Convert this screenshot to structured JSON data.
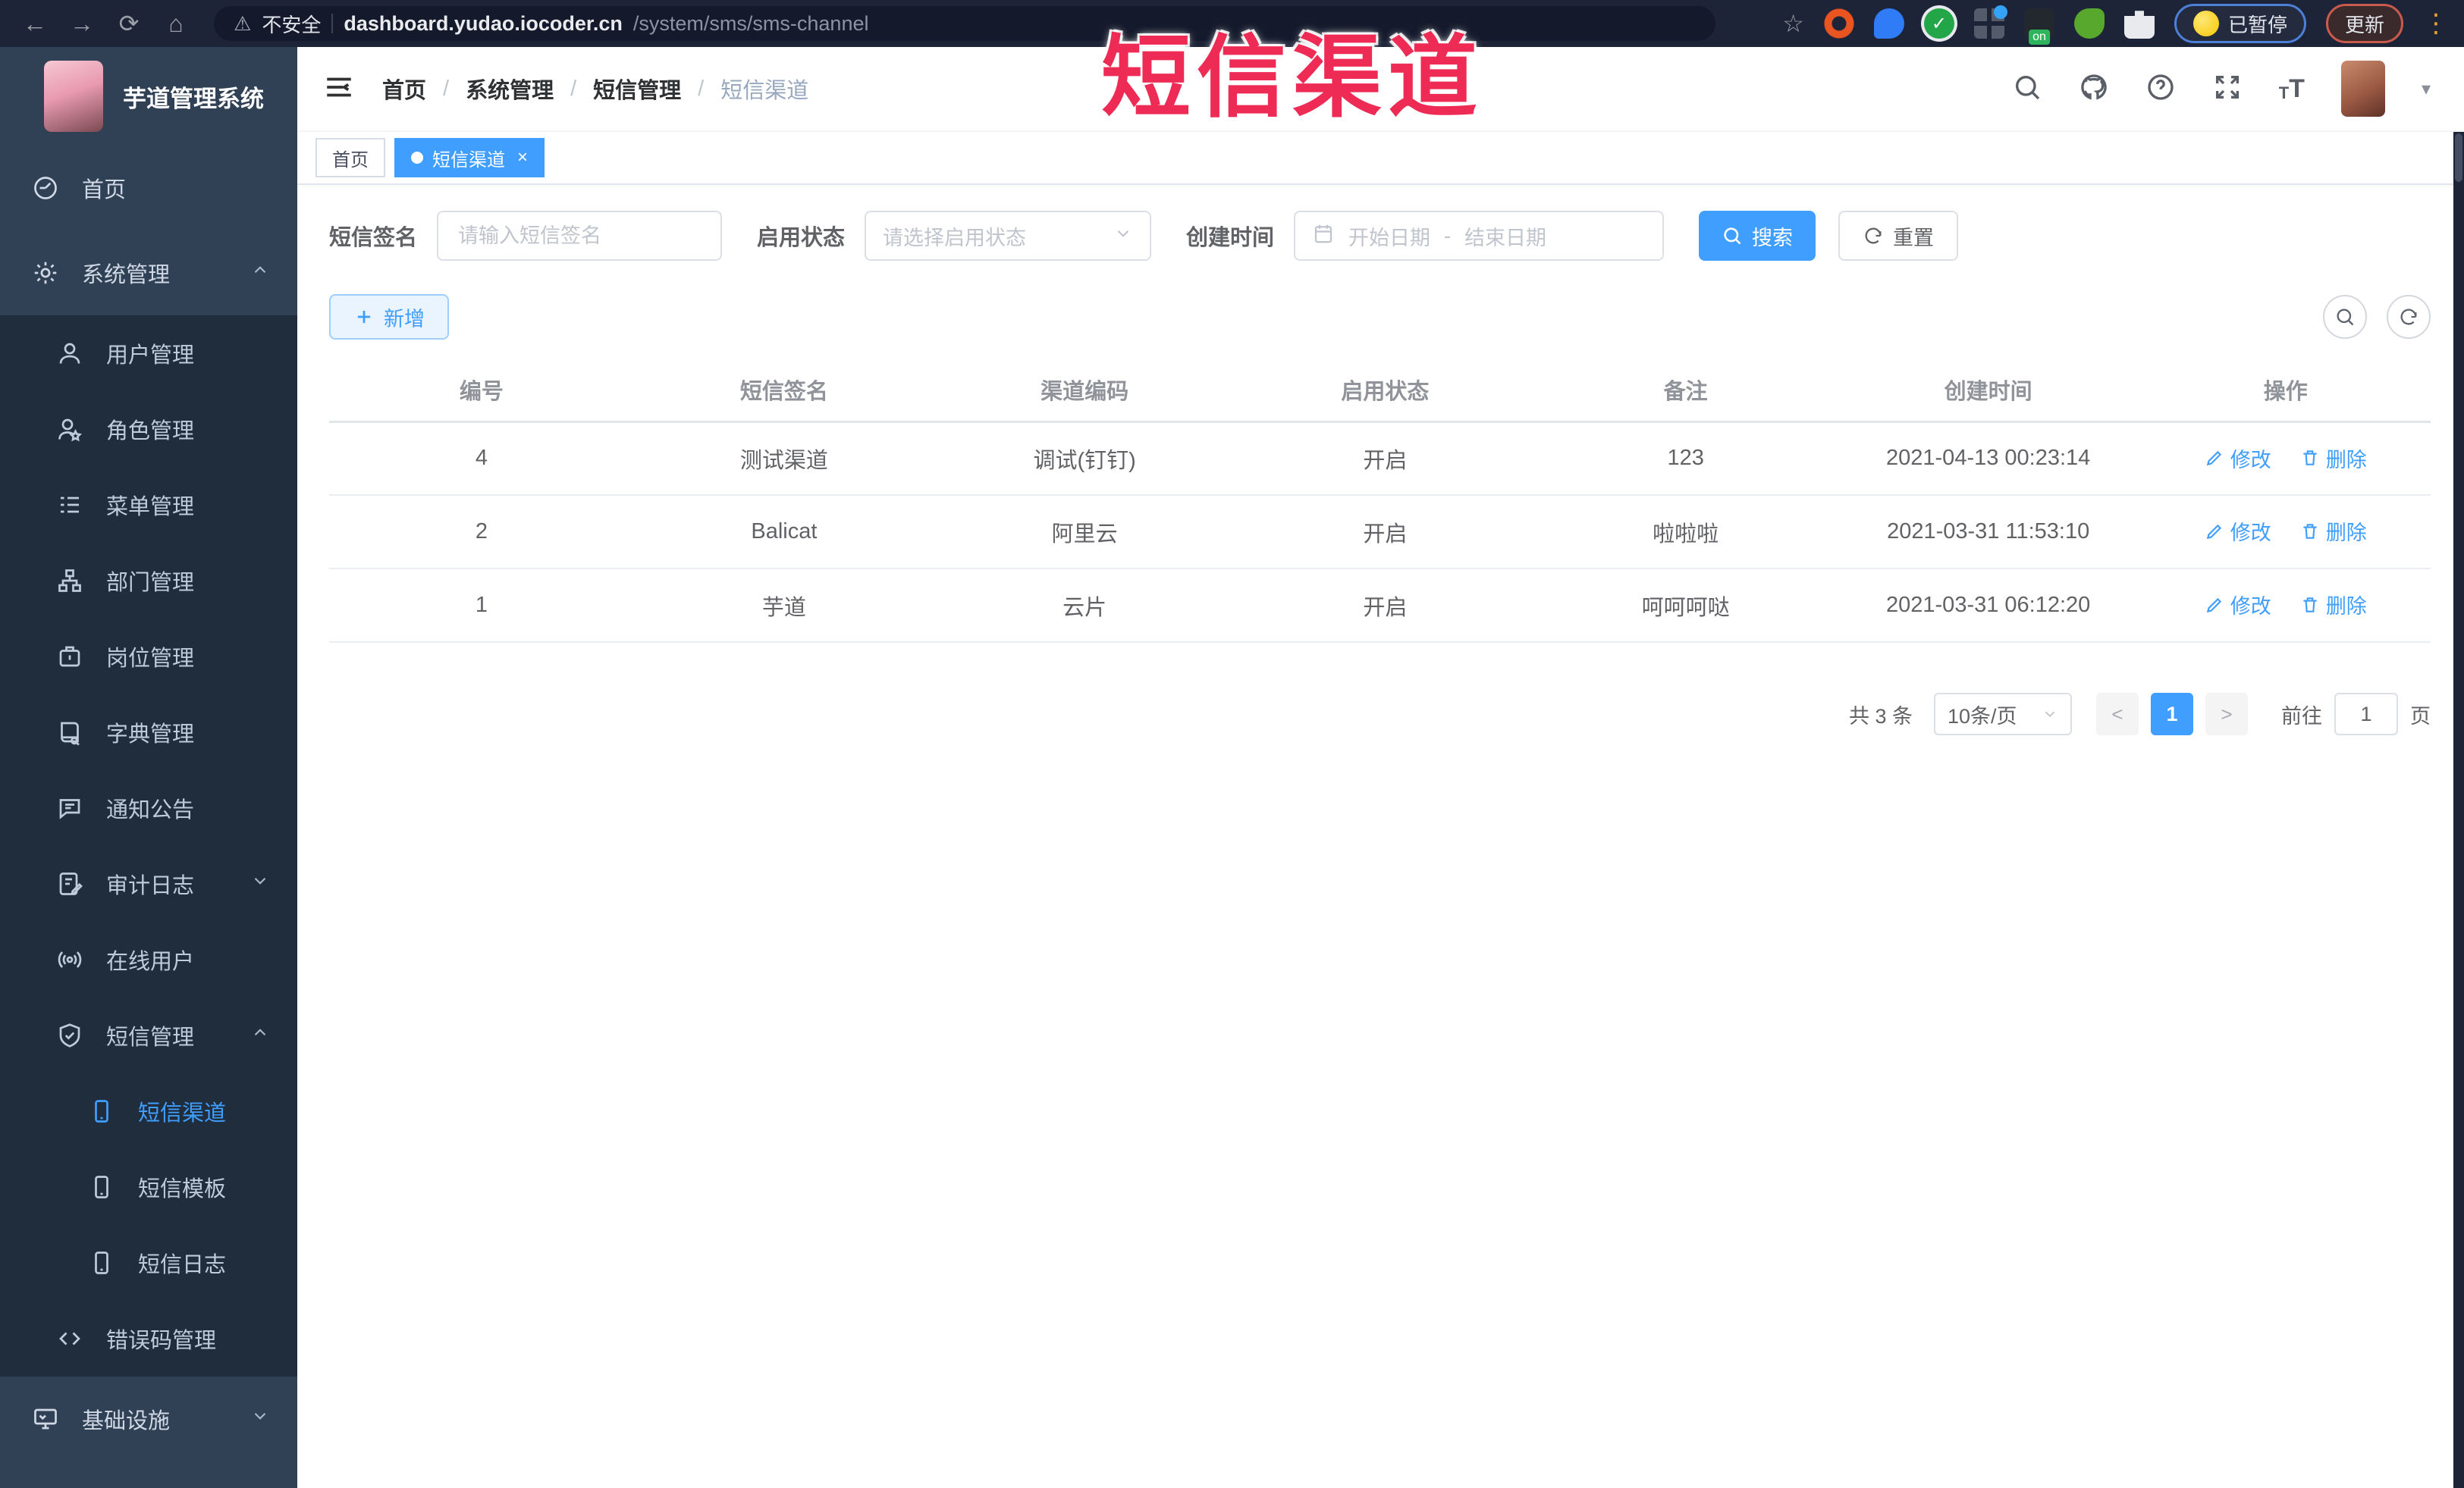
{
  "browser": {
    "security_label": "不安全",
    "url_host": "dashboard.yudao.iocoder.cn",
    "url_path": "/system/sms/sms-channel",
    "paused_label": "已暂停",
    "update_label": "更新"
  },
  "overlay": {
    "title": "短信渠道",
    "color": "#ee2b54"
  },
  "sidebar": {
    "app_title": "芋道管理系统",
    "items": [
      {
        "label": "首页",
        "icon": "dashboard-icon",
        "level": 1
      },
      {
        "label": "系统管理",
        "icon": "gear-icon",
        "level": 1,
        "state": "expanded"
      },
      {
        "label": "用户管理",
        "icon": "user-icon",
        "level": 2
      },
      {
        "label": "角色管理",
        "icon": "role-icon",
        "level": 2
      },
      {
        "label": "菜单管理",
        "icon": "menu-list-icon",
        "level": 2
      },
      {
        "label": "部门管理",
        "icon": "org-tree-icon",
        "level": 2
      },
      {
        "label": "岗位管理",
        "icon": "post-icon",
        "level": 2
      },
      {
        "label": "字典管理",
        "icon": "dict-icon",
        "level": 2
      },
      {
        "label": "通知公告",
        "icon": "notice-icon",
        "level": 2
      },
      {
        "label": "审计日志",
        "icon": "audit-log-icon",
        "level": 2,
        "state": "collapsed"
      },
      {
        "label": "在线用户",
        "icon": "online-user-icon",
        "level": 2
      },
      {
        "label": "短信管理",
        "icon": "sms-shield-icon",
        "level": 2,
        "state": "expanded"
      },
      {
        "label": "短信渠道",
        "icon": "phone-icon",
        "level": 3,
        "active": true
      },
      {
        "label": "短信模板",
        "icon": "phone-icon",
        "level": 3
      },
      {
        "label": "短信日志",
        "icon": "phone-icon",
        "level": 3
      },
      {
        "label": "错误码管理",
        "icon": "code-icon",
        "level": 2
      },
      {
        "label": "基础设施",
        "icon": "infra-icon",
        "level": 1,
        "state": "collapsed"
      }
    ]
  },
  "breadcrumb": {
    "items": [
      "首页",
      "系统管理",
      "短信管理",
      "短信渠道"
    ],
    "separator": "/"
  },
  "tabs": [
    {
      "label": "首页"
    },
    {
      "label": "短信渠道",
      "active": true,
      "close": "×"
    }
  ],
  "filters": {
    "signature_label": "短信签名",
    "signature_placeholder": "请输入短信签名",
    "status_label": "启用状态",
    "status_placeholder": "请选择启用状态",
    "time_label": "创建时间",
    "date_start_placeholder": "开始日期",
    "date_separator": "-",
    "date_end_placeholder": "结束日期",
    "search_label": "搜索",
    "reset_label": "重置"
  },
  "toolbar": {
    "add_label": "新增"
  },
  "table": {
    "columns": [
      "编号",
      "短信签名",
      "渠道编码",
      "启用状态",
      "备注",
      "创建时间",
      "操作"
    ],
    "edit_label": "修改",
    "delete_label": "删除",
    "rows": [
      {
        "id": "4",
        "signature": "测试渠道",
        "code": "调试(钉钉)",
        "status": "开启",
        "remark": "123",
        "created": "2021-04-13 00:23:14"
      },
      {
        "id": "2",
        "signature": "Balicat",
        "code": "阿里云",
        "status": "开启",
        "remark": "啦啦啦",
        "created": "2021-03-31 11:53:10"
      },
      {
        "id": "1",
        "signature": "芋道",
        "code": "云片",
        "status": "开启",
        "remark": "呵呵呵哒",
        "created": "2021-03-31 06:12:20"
      }
    ]
  },
  "pagination": {
    "total_label": "共 3 条",
    "page_size_label": "10条/页",
    "current_page": "1",
    "goto_label": "前往",
    "goto_value": "1",
    "page_label": "页"
  },
  "colors": {
    "accent": "#409EFF",
    "sidebar_bg": "#304156",
    "submenu_bg": "#1f2d3d",
    "chrome_bg": "#1d2438",
    "overlay_red": "#ee2b54"
  }
}
